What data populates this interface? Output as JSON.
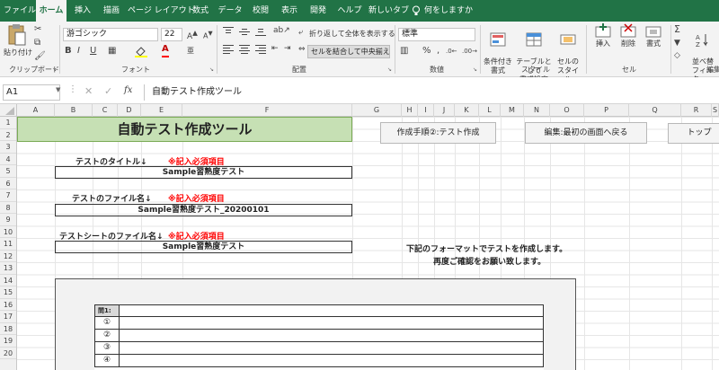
{
  "tabs": [
    "ファイル",
    "ホーム",
    "挿入",
    "描画",
    "ページ レイアウト",
    "数式",
    "データ",
    "校閲",
    "表示",
    "開発",
    "ヘルプ",
    "新しいタブ",
    "何をしますか"
  ],
  "ribbon": {
    "clipboard": {
      "paste": "貼り付け",
      "label": "クリップボード"
    },
    "font": {
      "name": "游ゴシック",
      "size": "22",
      "label": "フォント"
    },
    "alignment": {
      "wrap": "折り返して全体を表示する",
      "merge": "セルを結合して中央揃え",
      "label": "配置"
    },
    "number": {
      "format": "標準",
      "label": "数値"
    },
    "styles": {
      "conditional": "条件付き\n書式",
      "table": "テーブルとして\n書式設定",
      "cell": "セルの\nスタイル",
      "label": "スタイル"
    },
    "cells": {
      "insert": "挿入",
      "delete": "削除",
      "format": "書式",
      "label": "セル"
    },
    "editing": {
      "sort": "並べ替\nフィルタ",
      "label": "編集"
    }
  },
  "formula_bar": {
    "namebox": "A1",
    "content": "自動テスト作成ツール"
  },
  "columns": [
    "A",
    "B",
    "C",
    "D",
    "E",
    "F",
    "G",
    "H",
    "I",
    "J",
    "K",
    "L",
    "M",
    "N",
    "O",
    "P",
    "Q",
    "R",
    "S"
  ],
  "rows": [
    "1",
    "2",
    "3",
    "4",
    "5",
    "6",
    "7",
    "8",
    "9",
    "10",
    "11",
    "12",
    "13",
    "14",
    "15",
    "16",
    "17",
    "18",
    "19",
    "20"
  ],
  "sheet": {
    "title": "自動テスト作成ツール",
    "btn_create": "作成手順②:テスト作成",
    "btn_back": "編集:最初の画面へ戻る",
    "btn_top": "トップ",
    "label_title": "テストのタイトル↓",
    "label_file": "テストのファイル名↓",
    "label_sheet": "テストシートのファイル名↓",
    "required": "※記入必須項目",
    "value_title": "Sample習熟度テスト",
    "value_file": "Sample習熟度テスト_20200101",
    "value_sheet": "Sample習熟度テスト",
    "note1": "下記のフォーマットでテストを作成します。",
    "note2": "再度ご確認をお願い致します。",
    "q_header": "問1:",
    "options": [
      "①",
      "②",
      "③",
      "④"
    ]
  }
}
